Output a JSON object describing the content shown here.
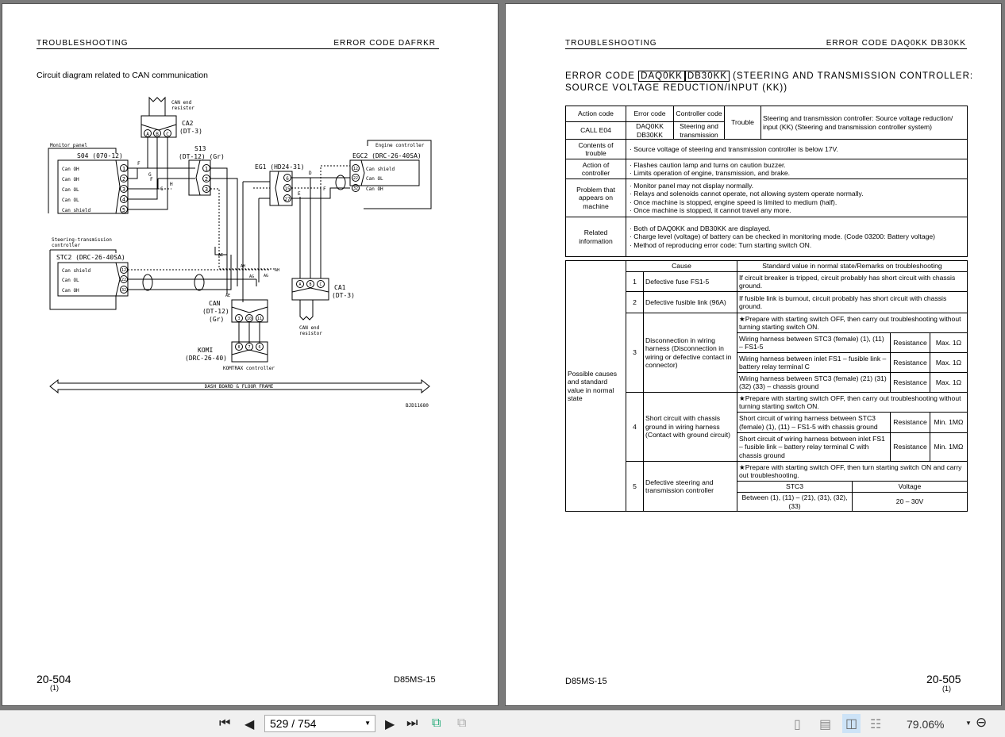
{
  "left_page": {
    "header_left": "TROUBLESHOOTING",
    "header_right": "ERROR CODE  DAFRKR",
    "section_title": "Circuit diagram related to CAN communication",
    "page_number": "20-504",
    "page_sub": "(1)",
    "model": "D85MS-15",
    "diagram": {
      "monitor_panel": "Monitor panel",
      "s04": "S04 (070-12)",
      "s04_pins": [
        "1",
        "2",
        "3",
        "4",
        "5"
      ],
      "s04_signals": [
        "Can OH",
        "Can OH",
        "Can OL",
        "Can OL",
        "Can shield"
      ],
      "ca2": "CA2",
      "ca2_type": "(DT-3)",
      "ca_pins": [
        "A",
        "B",
        "C"
      ],
      "can_end_1": "CAN end",
      "can_end_2": "resistor",
      "s13": "S13",
      "s13_type": "(DT-12) (Gr)",
      "s13_pins": [
        "1",
        "2",
        "3"
      ],
      "eg1": "EG1 (HD24-31)",
      "eg1_pins": [
        "6",
        "15",
        "27"
      ],
      "engine_controller": "Engine controller",
      "egc2": "EGC2 (DRC-26-40SA)",
      "egc2_pins": [
        "12",
        "22",
        "32"
      ],
      "egc2_signals": [
        "Can shield",
        "Can OL",
        "Can OH"
      ],
      "stc_controller_1": "Steering-transmission",
      "stc_controller_2": "controller",
      "stc2": "STC2 (DRC-26-40SA)",
      "stc2_pins": [
        "12",
        "22",
        "32"
      ],
      "stc2_signals": [
        "Can shield",
        "Can OL",
        "Can OH"
      ],
      "can": "CAN",
      "can_type": "(DT-12)",
      "can_color": "(Gr)",
      "can_pins": [
        "3",
        "10",
        "11"
      ],
      "komi": "KOMI",
      "komi_type": "(DRC-26-40)",
      "komi_pins": [
        "8",
        "7",
        "6"
      ],
      "komtrax": "KOMTRAX controller",
      "ca1": "CA1",
      "ca1_type": "(DT-3)",
      "splices": {
        "F": "F",
        "G": "G",
        "H": "H",
        "D": "D",
        "E": "E",
        "AE": "AE",
        "AH": "AH",
        "AG": "AG"
      },
      "frame": "DASH BOARD & FLOOR FRAME",
      "figure_id": "BJD11680"
    }
  },
  "right_page": {
    "header_left": "TROUBLESHOOTING",
    "header_right": "ERROR CODE  DAQ0KK  DB30KK",
    "title_prefix": "ERROR CODE",
    "code1": "DAQ0KK",
    "code2": "DB30KK",
    "title_rest": "(STEERING AND TRANSMISSION CONTROLLER:",
    "title_line2": "SOURCE VOLTAGE REDUCTION/INPUT (KK))",
    "page_number": "20-505",
    "page_sub": "(1)",
    "model": "D85MS-15",
    "info_table": {
      "action_code_label": "Action code",
      "error_code_label": "Error code",
      "controller_code_label": "Controller code",
      "trouble_label": "Trouble",
      "trouble_text": "Steering and transmission controller: Source voltage reduction/ input (KK) (Steering and transmission controller system)",
      "action_code": "CALL E04",
      "error_codes": "DAQ0KK DB30KK",
      "controller_code": "Steering and transmission",
      "rows": [
        {
          "label": "Contents of trouble",
          "items": [
            "Source voltage of steering and transmission controller is below 17V."
          ]
        },
        {
          "label": "Action of controller",
          "items": [
            "Flashes caution lamp and turns on caution buzzer.",
            "Limits operation of engine, transmission, and brake."
          ]
        },
        {
          "label": "Problem that appears on machine",
          "items": [
            "Monitor panel may not display normally.",
            "Relays and solenoids cannot operate, not allowing system operate normally.",
            "Once machine is stopped, engine speed is limited to medium (half).",
            "Once machine is stopped, it cannot travel any more."
          ]
        },
        {
          "label": "Related information",
          "items": [
            "Both of DAQ0KK and DB30KK are displayed.",
            "Charge level (voltage) of battery can be checked in monitoring mode. (Code 03200: Battery voltage)",
            "Method of reproducing error code: Turn starting switch ON."
          ]
        }
      ]
    },
    "cause_table": {
      "side_label": "Possible causes and standard value in normal state",
      "cause_header": "Cause",
      "standard_header": "Standard value in normal state/Remarks on troubleshooting",
      "causes": [
        {
          "no": "1",
          "cause": "Defective fuse FS1-5",
          "remark": "If circuit breaker is tripped, circuit probably has short circuit with chassis ground."
        },
        {
          "no": "2",
          "cause": "Defective fusible link (96A)",
          "remark": "If fusible link is burnout, circuit probably has short circuit with chassis ground."
        },
        {
          "no": "3",
          "cause": "Disconnection in wiring harness (Disconnection in wiring or defective contact in connector)",
          "note": "★Prepare with starting switch OFF, then carry out troubleshooting without turning starting switch ON.",
          "checks": [
            {
              "item": "Wiring harness between STC3 (female) (1), (11) – FS1-5",
              "type": "Resistance",
              "value": "Max. 1Ω"
            },
            {
              "item": "Wiring harness between inlet FS1 – fusible link – battery relay terminal C",
              "type": "Resistance",
              "value": "Max. 1Ω"
            },
            {
              "item": "Wiring harness between STC3 (female) (21) (31) (32) (33) – chassis ground",
              "type": "Resistance",
              "value": "Max. 1Ω"
            }
          ]
        },
        {
          "no": "4",
          "cause": "Short circuit with chassis ground in wiring harness (Contact with ground circuit)",
          "note": "★Prepare with starting switch OFF, then carry out troubleshooting without turning starting switch ON.",
          "checks": [
            {
              "item": "Short circuit of wiring harness between STC3 (female) (1), (11) – FS1-5 with chassis ground",
              "type": "Resistance",
              "value": "Min. 1MΩ"
            },
            {
              "item": "Short circuit of wiring harness between inlet FS1 – fusible link – battery relay terminal C with chassis ground",
              "type": "Resistance",
              "value": "Min. 1MΩ"
            }
          ]
        },
        {
          "no": "5",
          "cause": "Defective steering and transmission controller",
          "note": "★Prepare with starting switch OFF, then turn starting switch ON and carry out troubleshooting.",
          "col1": "STC3",
          "col2": "Voltage",
          "val1": "Between (1), (11) – (21), (31), (32), (33)",
          "val2": "20 – 30V"
        }
      ]
    }
  },
  "toolbar": {
    "first_icon": "first-page-icon",
    "prev_icon": "prev-page-icon",
    "next_icon": "next-page-icon",
    "last_icon": "last-page-icon",
    "page_value": "529 / 754",
    "zoom": "79.06%"
  }
}
